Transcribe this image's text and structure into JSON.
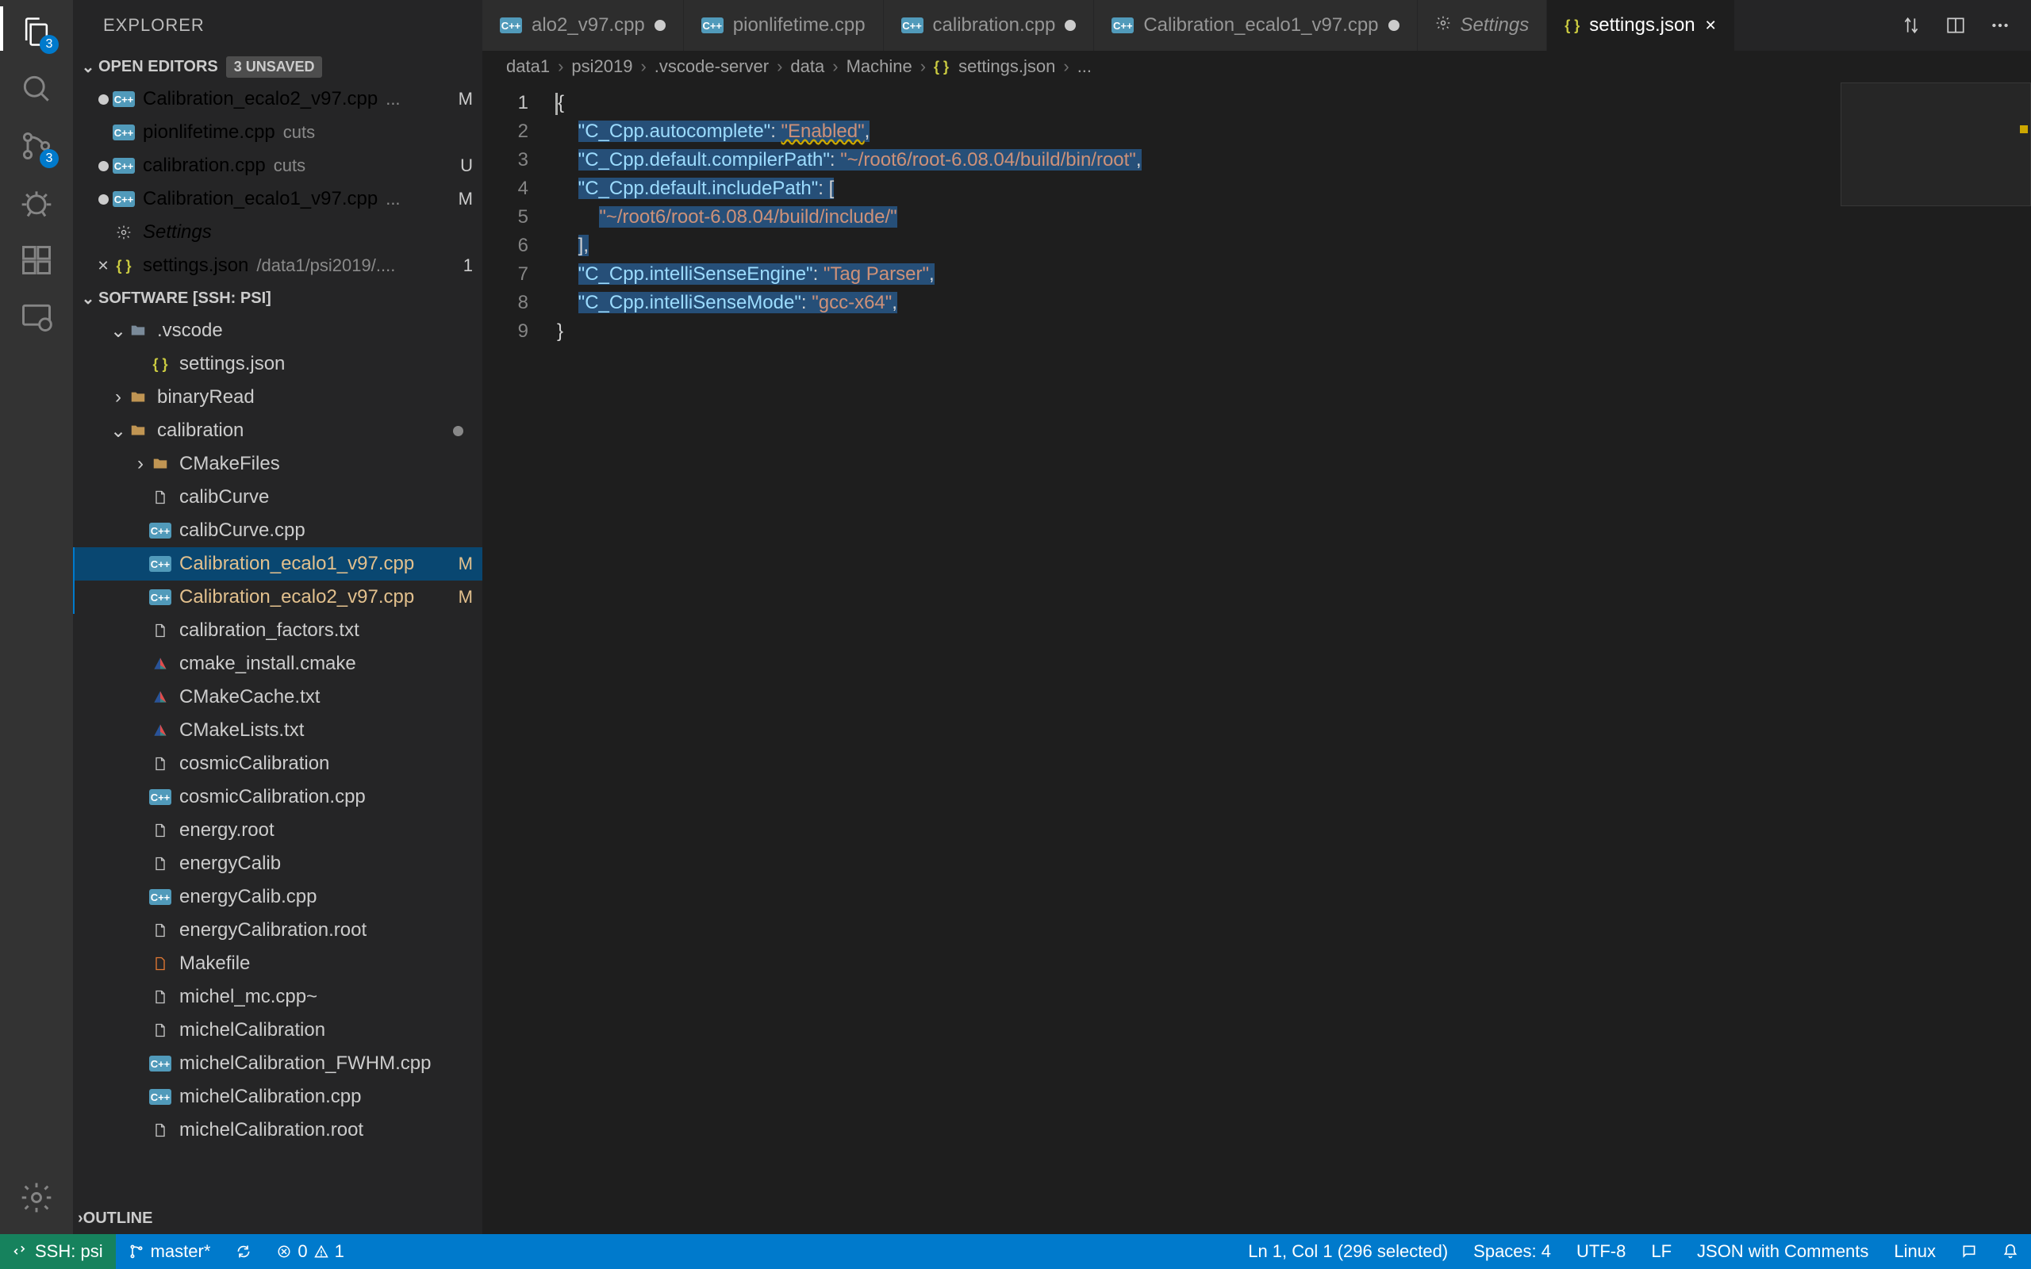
{
  "sidebar_title": "EXPLORER",
  "open_editors": {
    "header": "OPEN EDITORS",
    "badge": "3 UNSAVED",
    "items": [
      {
        "name": "Calibration_ecalo2_v97.cpp",
        "suffix": "...",
        "decor": "M",
        "icon": "cpp",
        "dirty": true
      },
      {
        "name": "pionlifetime.cpp",
        "suffix": "cuts",
        "decor": "",
        "icon": "cpp",
        "dirty": false
      },
      {
        "name": "calibration.cpp",
        "suffix": "cuts",
        "decor": "U",
        "icon": "cpp",
        "dirty": true
      },
      {
        "name": "Calibration_ecalo1_v97.cpp",
        "suffix": "...",
        "decor": "M",
        "icon": "cpp",
        "dirty": true
      },
      {
        "name": "Settings",
        "suffix": "",
        "decor": "",
        "icon": "gear",
        "dirty": false
      },
      {
        "name": "settings.json",
        "suffix": "/data1/psi2019/....",
        "decor": "1",
        "icon": "json",
        "dirty": false,
        "close": true
      }
    ]
  },
  "workspace": {
    "header": "SOFTWARE [SSH: PSI]",
    "items": [
      {
        "indent": 1,
        "name": ".vscode",
        "icon": "folder-dot",
        "chev": "down"
      },
      {
        "indent": 2,
        "name": "settings.json",
        "icon": "json"
      },
      {
        "indent": 1,
        "name": "binaryRead",
        "icon": "folder",
        "chev": "right"
      },
      {
        "indent": 1,
        "name": "calibration",
        "icon": "folder-open",
        "chev": "down",
        "dot": true
      },
      {
        "indent": 2,
        "name": "CMakeFiles",
        "icon": "folder",
        "chev": "right"
      },
      {
        "indent": 2,
        "name": "calibCurve",
        "icon": "file"
      },
      {
        "indent": 2,
        "name": "calibCurve.cpp",
        "icon": "cpp"
      },
      {
        "indent": 2,
        "name": "Calibration_ecalo1_v97.cpp",
        "icon": "cpp",
        "decor": "M",
        "selected": true,
        "modified": true
      },
      {
        "indent": 2,
        "name": "Calibration_ecalo2_v97.cpp",
        "icon": "cpp",
        "decor": "M",
        "modified": true
      },
      {
        "indent": 2,
        "name": "calibration_factors.txt",
        "icon": "file"
      },
      {
        "indent": 2,
        "name": "cmake_install.cmake",
        "icon": "cmake"
      },
      {
        "indent": 2,
        "name": "CMakeCache.txt",
        "icon": "cmake"
      },
      {
        "indent": 2,
        "name": "CMakeLists.txt",
        "icon": "cmake"
      },
      {
        "indent": 2,
        "name": "cosmicCalibration",
        "icon": "file"
      },
      {
        "indent": 2,
        "name": "cosmicCalibration.cpp",
        "icon": "cpp"
      },
      {
        "indent": 2,
        "name": "energy.root",
        "icon": "file"
      },
      {
        "indent": 2,
        "name": "energyCalib",
        "icon": "file"
      },
      {
        "indent": 2,
        "name": "energyCalib.cpp",
        "icon": "cpp"
      },
      {
        "indent": 2,
        "name": "energyCalibration.root",
        "icon": "file"
      },
      {
        "indent": 2,
        "name": "Makefile",
        "icon": "make"
      },
      {
        "indent": 2,
        "name": "michel_mc.cpp~",
        "icon": "file"
      },
      {
        "indent": 2,
        "name": "michelCalibration",
        "icon": "file"
      },
      {
        "indent": 2,
        "name": "michelCalibration_FWHM.cpp",
        "icon": "cpp"
      },
      {
        "indent": 2,
        "name": "michelCalibration.cpp",
        "icon": "cpp"
      },
      {
        "indent": 2,
        "name": "michelCalibration.root",
        "icon": "file"
      }
    ]
  },
  "outline_header": "OUTLINE",
  "tabs": [
    {
      "label": "alo2_v97.cpp",
      "icon": "cpp",
      "dirty": true
    },
    {
      "label": "pionlifetime.cpp",
      "icon": "cpp"
    },
    {
      "label": "calibration.cpp",
      "icon": "cpp",
      "dirty": true
    },
    {
      "label": "Calibration_ecalo1_v97.cpp",
      "icon": "cpp",
      "dirty": true
    },
    {
      "label": "Settings",
      "icon": "gear"
    },
    {
      "label": "settings.json",
      "icon": "json",
      "active": true,
      "close": true
    }
  ],
  "breadcrumb": [
    "data1",
    "psi2019",
    ".vscode-server",
    "data",
    "Machine",
    "settings.json",
    "..."
  ],
  "breadcrumb_icon_index": 5,
  "editor": {
    "lines": [
      [
        {
          "t": "{",
          "c": "punc",
          "hl": false
        }
      ],
      [
        {
          "t": "    ",
          "c": "punc"
        },
        {
          "t": "\"C_Cpp.autocomplete\"",
          "c": "key",
          "hl": true
        },
        {
          "t": ": ",
          "c": "punc",
          "hl": true
        },
        {
          "t": "\"Enabled\"",
          "c": "str",
          "hl": true,
          "warn": true
        },
        {
          "t": ",",
          "c": "punc",
          "hl": true
        }
      ],
      [
        {
          "t": "    ",
          "c": "punc"
        },
        {
          "t": "\"C_Cpp.default.compilerPath\"",
          "c": "key",
          "hl": true
        },
        {
          "t": ": ",
          "c": "punc",
          "hl": true
        },
        {
          "t": "\"~/root6/root-6.08.04/build/bin/root\"",
          "c": "str",
          "hl": true
        },
        {
          "t": ",",
          "c": "punc",
          "hl": true
        }
      ],
      [
        {
          "t": "    ",
          "c": "punc"
        },
        {
          "t": "\"C_Cpp.default.includePath\"",
          "c": "key",
          "hl": true
        },
        {
          "t": ": [",
          "c": "punc",
          "hl": true
        }
      ],
      [
        {
          "t": "        ",
          "c": "punc"
        },
        {
          "t": "\"~/root6/root-6.08.04/build/include/\"",
          "c": "str",
          "hl": true
        }
      ],
      [
        {
          "t": "    ",
          "c": "punc"
        },
        {
          "t": "],",
          "c": "punc",
          "hl": true
        }
      ],
      [
        {
          "t": "    ",
          "c": "punc"
        },
        {
          "t": "\"C_Cpp.intelliSenseEngine\"",
          "c": "key",
          "hl": true
        },
        {
          "t": ": ",
          "c": "punc",
          "hl": true
        },
        {
          "t": "\"Tag Parser\"",
          "c": "str",
          "hl": true
        },
        {
          "t": ",",
          "c": "punc",
          "hl": true
        }
      ],
      [
        {
          "t": "    ",
          "c": "punc"
        },
        {
          "t": "\"C_Cpp.intelliSenseMode\"",
          "c": "key",
          "hl": true
        },
        {
          "t": ": ",
          "c": "punc",
          "hl": true
        },
        {
          "t": "\"gcc-x64\"",
          "c": "str",
          "hl": true
        },
        {
          "t": ",",
          "c": "punc",
          "hl": true
        }
      ],
      [
        {
          "t": "}",
          "c": "punc"
        }
      ]
    ]
  },
  "status": {
    "remote": "SSH: psi",
    "branch": "master*",
    "errors": "0",
    "warnings": "1",
    "cursor": "Ln 1, Col 1 (296 selected)",
    "spaces": "Spaces: 4",
    "encoding": "UTF-8",
    "eol": "LF",
    "lang": "JSON with Comments",
    "os": "Linux"
  },
  "activity_badges": {
    "explorer": "3",
    "scm": "3"
  }
}
